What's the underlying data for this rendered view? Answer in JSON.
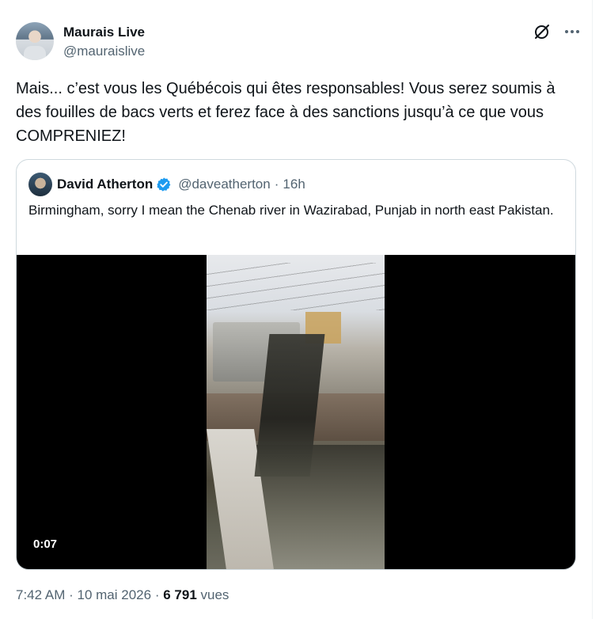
{
  "tweet": {
    "author": {
      "display_name": "Maurais Live",
      "handle": "@mauraislive"
    },
    "text": "Mais... c’est vous les Québécois qui êtes responsables! Vous serez soumis à des fouilles de bacs verts et ferez face à des sanctions jusqu’à ce que vous COMPRENIEZ!",
    "time": "7:42 AM",
    "separator": "·",
    "date": "10 mai 2026",
    "views_count": "6 791",
    "views_label": "vues"
  },
  "quote": {
    "author": {
      "display_name": "David Atherton",
      "handle": "@daveatherton",
      "verified": true
    },
    "separator": "·",
    "age": "16h",
    "text": "Birmingham, sorry I mean the Chenab river in Wazirabad, Punjab in north east Pakistan.",
    "video": {
      "duration": "0:07"
    }
  },
  "icons": {
    "grok": "grok-icon",
    "more": "more-icon",
    "verified": "verified-badge-icon"
  },
  "colors": {
    "text_primary": "#0f1419",
    "text_secondary": "#536471",
    "verified_blue": "#1d9bf0",
    "border": "#cfd9de"
  }
}
